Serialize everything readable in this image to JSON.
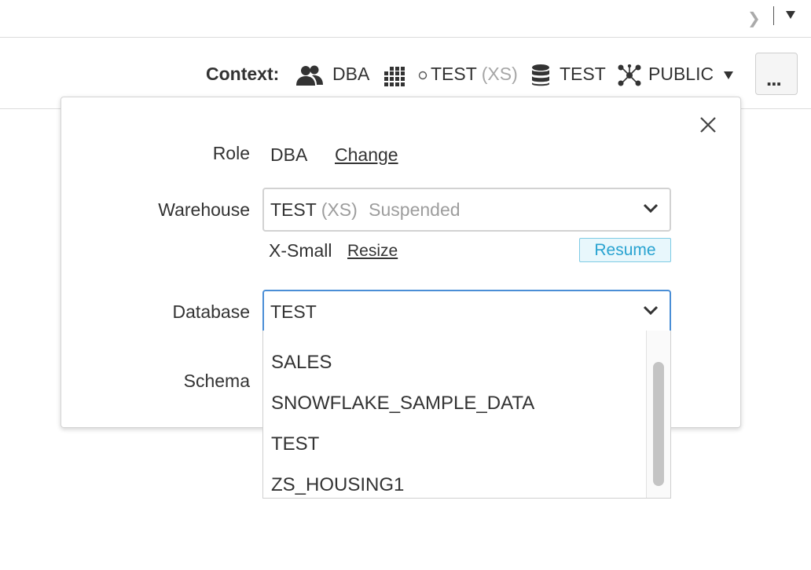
{
  "context_bar": {
    "label": "Context:",
    "role": "DBA",
    "warehouse_name": "TEST",
    "warehouse_size": "(XS)",
    "database": "TEST",
    "schema": "PUBLIC",
    "more_label": "..."
  },
  "panel": {
    "role_label": "Role",
    "role_value": "DBA",
    "change_link": "Change",
    "warehouse_label": "Warehouse",
    "warehouse_select": {
      "name": "TEST",
      "size": "(XS)",
      "status": "Suspended"
    },
    "warehouse_size_text": "X-Small",
    "resize_link": "Resize",
    "resume_button": "Resume",
    "database_label": "Database",
    "database_value": "TEST",
    "schema_label": "Schema",
    "database_options": [
      "SALES",
      "SNOWFLAKE_SAMPLE_DATA",
      "TEST",
      "ZS_HOUSING1"
    ]
  },
  "colors": {
    "focus_border": "#4a8ed6",
    "resume_text": "#29a3d1",
    "resume_bg": "#e8f7fc",
    "muted_text": "#9d9d9d"
  },
  "icons": {
    "topbar": [
      "chevron-right-icon",
      "chevron-down-icon"
    ],
    "context": [
      "users-icon",
      "warehouse-grid-icon",
      "status-circle-icon",
      "database-icon",
      "schema-network-icon",
      "caret-down-icon"
    ],
    "panel": [
      "close-icon",
      "chevron-down-icon"
    ]
  }
}
